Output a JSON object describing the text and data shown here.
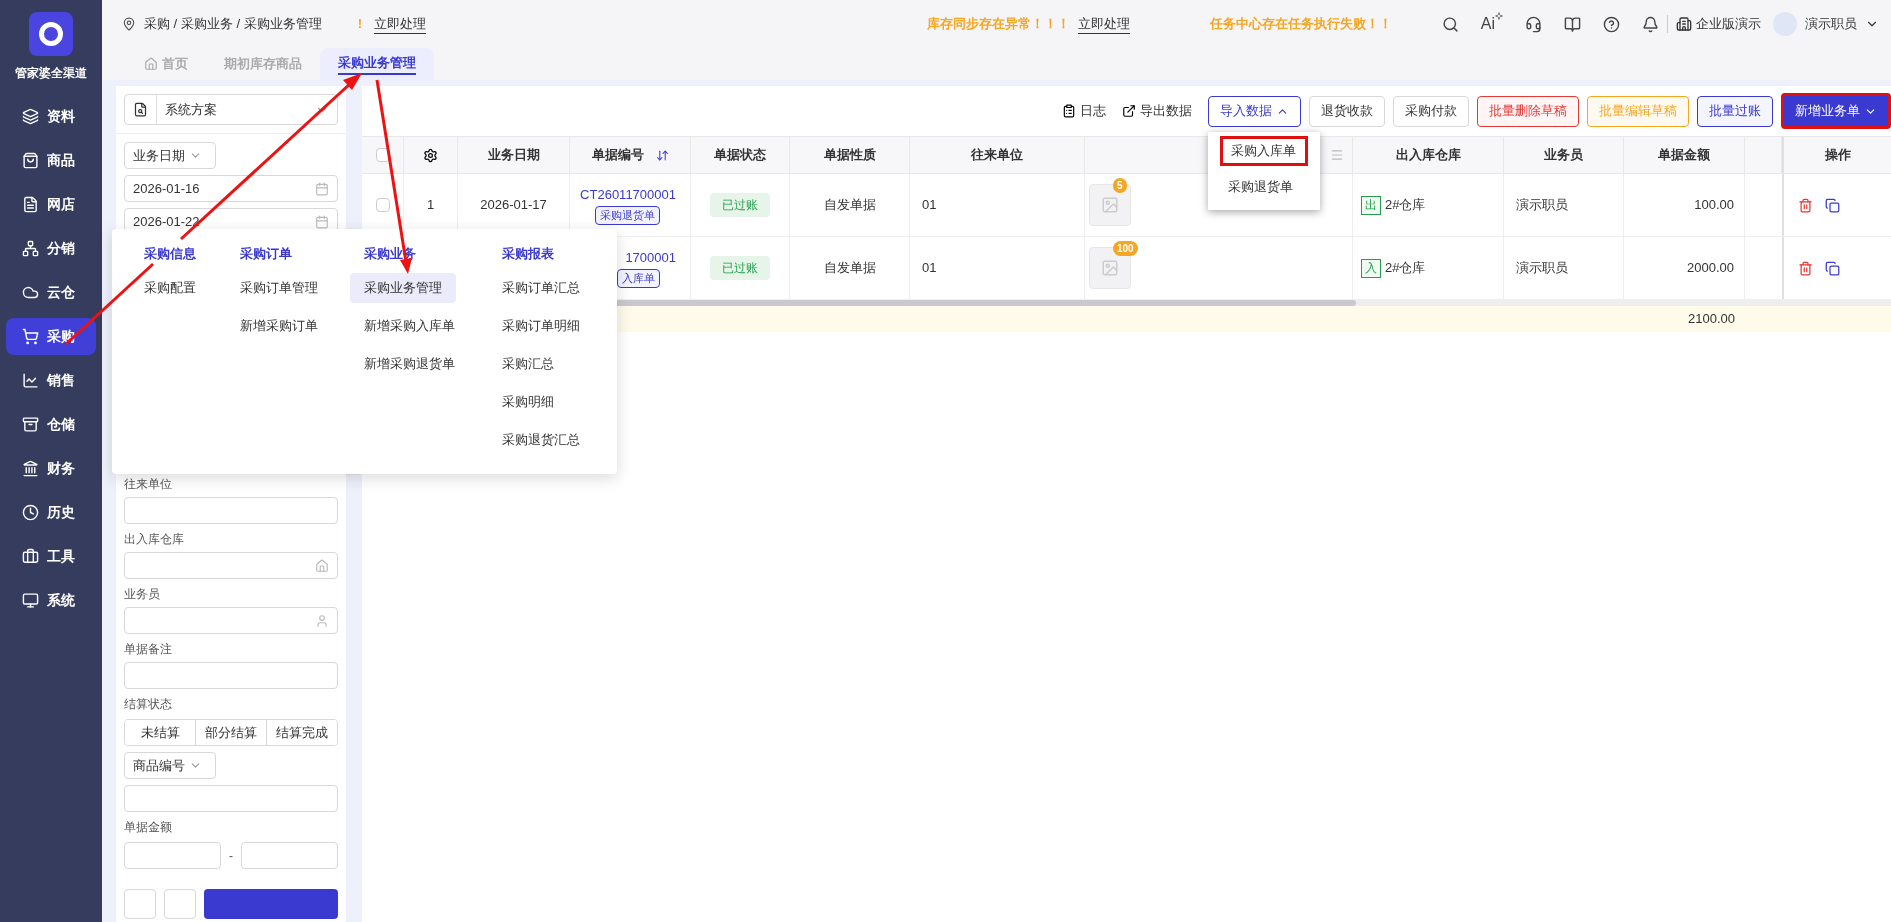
{
  "brand": {
    "name": "管家婆全渠道"
  },
  "sidebar": {
    "items": [
      {
        "label": "资料",
        "selected": false
      },
      {
        "label": "商品",
        "selected": false
      },
      {
        "label": "网店",
        "selected": false
      },
      {
        "label": "分销",
        "selected": false
      },
      {
        "label": "云仓",
        "selected": false
      },
      {
        "label": "采购",
        "selected": true
      },
      {
        "label": "销售",
        "selected": false
      },
      {
        "label": "仓储",
        "selected": false
      },
      {
        "label": "财务",
        "selected": false
      },
      {
        "label": "历史",
        "selected": false
      },
      {
        "label": "工具",
        "selected": false
      },
      {
        "label": "系统",
        "selected": false
      }
    ]
  },
  "header": {
    "breadcrumb": "采购 / 采购业务 / 采购业务管理",
    "alert_mark": "!",
    "alert_link": "立即处理",
    "notice": "库存同步存在异常！！！",
    "notice_link": "立即处理",
    "notice_2": "任务中心存在任务执行失败！！",
    "ai_label": "Ai",
    "company": "企业版演示",
    "user": "演示职员"
  },
  "tabs": [
    {
      "label": "首页",
      "selected": false
    },
    {
      "label": "期初库存商品",
      "selected": false
    },
    {
      "label": "采购业务管理",
      "selected": true
    }
  ],
  "filters": {
    "scheme": "系统方案",
    "date_type": "业务日期",
    "date_from": "2026-01-16",
    "date_to": "2026-01-22",
    "fields": [
      {
        "label": "往来单位",
        "kind": "text"
      },
      {
        "label": "出入库仓库",
        "kind": "warehouse"
      },
      {
        "label": "业务员",
        "kind": "person"
      },
      {
        "label": "单据备注",
        "kind": "text"
      }
    ],
    "settle_label": "结算状态",
    "settle_options": [
      {
        "label": "未结算",
        "selected": false
      },
      {
        "label": "部分结算",
        "selected": false
      },
      {
        "label": "结算完成",
        "selected": false
      }
    ],
    "product_type": "商品编号",
    "amount_label": "单据金额",
    "amount_sep": "-"
  },
  "toolbar": [
    {
      "label": "日志",
      "kind": "log"
    },
    {
      "label": "导出数据",
      "kind": "export"
    },
    {
      "label": "导入数据",
      "kind": "dropdown",
      "expanded": true
    },
    {
      "label": "退货收款",
      "kind": "plain"
    },
    {
      "label": "采购付款",
      "kind": "plain"
    },
    {
      "label": "批量删除草稿",
      "kind": "danger"
    },
    {
      "label": "批量编辑草稿",
      "kind": "warning"
    },
    {
      "label": "批量过账",
      "kind": "outline"
    },
    {
      "label": "新增业务单",
      "kind": "primary",
      "highlighted": true
    }
  ],
  "import_menu": [
    {
      "label": "采购入库单",
      "highlighted": true
    },
    {
      "label": "采购退货单",
      "highlighted": false
    }
  ],
  "table": {
    "columns": [
      "业务日期",
      "单据编号",
      "单据状态",
      "单据性质",
      "往来单位",
      "出入库仓库",
      "业务员",
      "单据金额",
      "操作"
    ],
    "select_all_checked": false,
    "rows": [
      {
        "checked": false,
        "index": "1",
        "date": "2026-01-17",
        "number": "CT26011700001",
        "doc_type": "采购退货单",
        "status": "已过账",
        "nature": "自发单据",
        "partner": "01",
        "image_count": "5",
        "direction": "出",
        "warehouse": "2#仓库",
        "clerk": "演示职员",
        "amount": "100.00"
      },
      {
        "index": "",
        "date": "",
        "number": "1700001",
        "doc_type": "入库单",
        "status": "已过账",
        "nature": "自发单据",
        "partner": "01",
        "image_count": "100",
        "direction": "入",
        "warehouse": "2#仓库",
        "clerk": "演示职员",
        "amount": "2000.00"
      }
    ],
    "total": "2100.00"
  },
  "mega_menu": {
    "columns": [
      {
        "title": "采购信息",
        "items": [
          {
            "label": "采购配置",
            "selected": false
          }
        ]
      },
      {
        "title": "采购订单",
        "items": [
          {
            "label": "采购订单管理",
            "selected": false
          },
          {
            "label": "新增采购订单",
            "selected": false
          }
        ]
      },
      {
        "title": "采购业务",
        "items": [
          {
            "label": "采购业务管理",
            "selected": true
          },
          {
            "label": "新增采购入库单",
            "selected": false
          },
          {
            "label": "新增采购退货单",
            "selected": false
          }
        ]
      },
      {
        "title": "采购报表",
        "items": [
          {
            "label": "采购订单汇总",
            "selected": false
          },
          {
            "label": "采购订单明细",
            "selected": false
          },
          {
            "label": "采购汇总",
            "selected": false
          },
          {
            "label": "采购明细",
            "selected": false
          },
          {
            "label": "采购退货汇总",
            "selected": false
          }
        ]
      }
    ]
  }
}
